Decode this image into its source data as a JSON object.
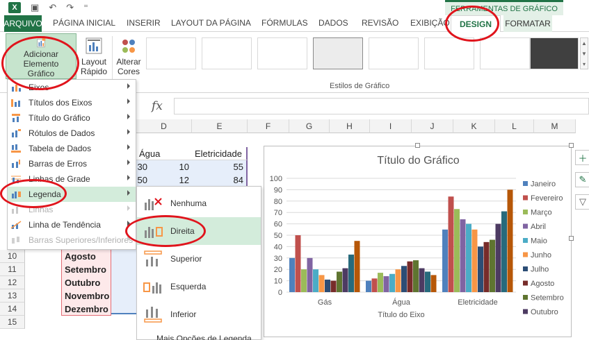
{
  "ribbon_tabs": {
    "file": "ARQUIVO",
    "home": "PÁGINA INICIAL",
    "insert": "INSERIR",
    "layout": "LAYOUT DA PÁGINA",
    "formulas": "FÓRMULAS",
    "data": "DADOS",
    "review": "REVISÃO",
    "view": "EXIBIÇÃO",
    "design": "DESIGN",
    "format": "FORMATAR"
  },
  "context_header": "FERRAMENTAS DE GRÁFICO",
  "ribbon": {
    "add_element": [
      "Adicionar Elemento",
      "Gráfico"
    ],
    "quick_layout": [
      "Layout",
      "Rápido"
    ],
    "change_colors": [
      "Alterar",
      "Cores"
    ],
    "chart_styles_group": "Estilos de Gráfico"
  },
  "formula_bar": {
    "fx": "fx"
  },
  "columns": [
    "D",
    "E",
    "F",
    "G",
    "H",
    "I",
    "J",
    "K",
    "L",
    "M"
  ],
  "rows": [
    "10",
    "11",
    "12",
    "13",
    "14",
    "15"
  ],
  "sheet": {
    "header_d": "Água",
    "header_e": "Eletricidade",
    "row_a": [
      "30",
      "10",
      "55"
    ],
    "row_b": [
      "50",
      "12",
      "84"
    ],
    "months": [
      "Agosto",
      "Setembro",
      "Outubro",
      "Novembro",
      "Dezembro"
    ]
  },
  "add_menu": {
    "items": [
      "Eixos",
      "Títulos dos Eixos",
      "Título do Gráfico",
      "Rótulos de Dados",
      "Tabela de Dados",
      "Barras de Erros",
      "Linhas de Grade",
      "Legenda",
      "Linhas",
      "Linha de Tendência",
      "Barras Superiores/Inferiores"
    ]
  },
  "legend_menu": {
    "items": [
      "Nenhuma",
      "Direita",
      "Superior",
      "Esquerda",
      "Inferior"
    ],
    "more": "Mais Opções de Legenda..."
  },
  "colors": {
    "excel_green": "#217346",
    "annotation_red": "#e0141c"
  },
  "chart_data": {
    "type": "bar",
    "title": "Título do Gráfico",
    "xlabel": "Título do Eixo",
    "ylabel": "",
    "ylim": [
      0,
      100
    ],
    "y_ticks": [
      0,
      10,
      20,
      30,
      40,
      50,
      60,
      70,
      80,
      90,
      100
    ],
    "categories": [
      "Gás",
      "Água",
      "Eletricidade"
    ],
    "legend_position": "right",
    "series": [
      {
        "name": "Janeiro",
        "color": "#4f81bd",
        "values": [
          30,
          10,
          55
        ]
      },
      {
        "name": "Fevereiro",
        "color": "#c0504d",
        "values": [
          50,
          12,
          84
        ]
      },
      {
        "name": "Março",
        "color": "#9bbb59",
        "values": [
          20,
          17,
          73
        ]
      },
      {
        "name": "Abril",
        "color": "#8064a2",
        "values": [
          30,
          14,
          64
        ]
      },
      {
        "name": "Maio",
        "color": "#4bacc6",
        "values": [
          20,
          16,
          60
        ]
      },
      {
        "name": "Junho",
        "color": "#f79646",
        "values": [
          15,
          20,
          55
        ]
      },
      {
        "name": "Julho",
        "color": "#2c4d75",
        "values": [
          11,
          23,
          40
        ]
      },
      {
        "name": "Agosto",
        "color": "#772c2a",
        "values": [
          10,
          27,
          44
        ]
      },
      {
        "name": "Setembro",
        "color": "#5f7530",
        "values": [
          18,
          28,
          46
        ]
      },
      {
        "name": "Outubro",
        "color": "#4d3b62",
        "values": [
          21,
          21,
          60
        ]
      },
      {
        "name": "Novembro",
        "color": "#276a7c",
        "values": [
          33,
          18,
          71
        ]
      },
      {
        "name": "Dezembro",
        "color": "#b65708",
        "values": [
          45,
          15,
          90
        ]
      }
    ],
    "legend_visible": [
      "Janeiro",
      "Fevereiro",
      "Março",
      "Abril",
      "Maio",
      "Junho",
      "Julho",
      "Agosto",
      "Setembro",
      "Outubro"
    ]
  }
}
